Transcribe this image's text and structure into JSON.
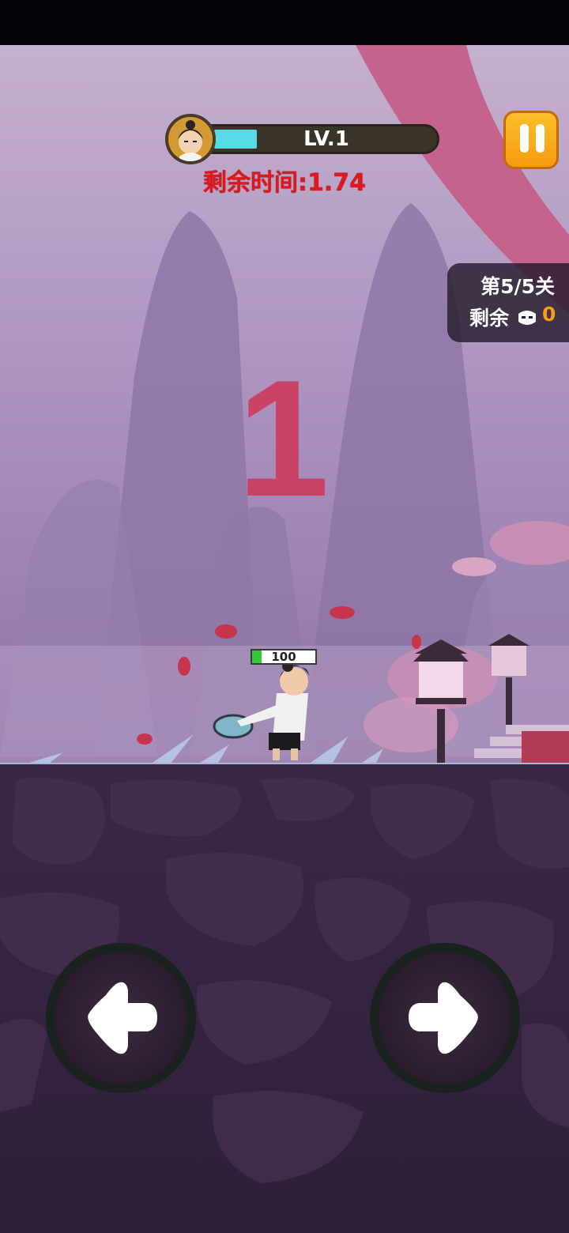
{
  "hud": {
    "level_label": "LV.1",
    "level_progress": 0.2,
    "timer_text": "剩余时间:1.74"
  },
  "stage": {
    "stage_text": "第5/5关",
    "remaining_label": "剩余",
    "remaining_count": "0"
  },
  "countdown": "1",
  "player": {
    "hp_text": "100",
    "hp_fill": 0.15
  },
  "controls": {
    "left_icon": "arrow-left-icon",
    "right_icon": "arrow-right-icon"
  },
  "colors": {
    "accent_orange": "#f49c10",
    "timer_red": "#e2171b",
    "level_fill": "#59dbe7",
    "remaining_count": "#ff9a12"
  }
}
